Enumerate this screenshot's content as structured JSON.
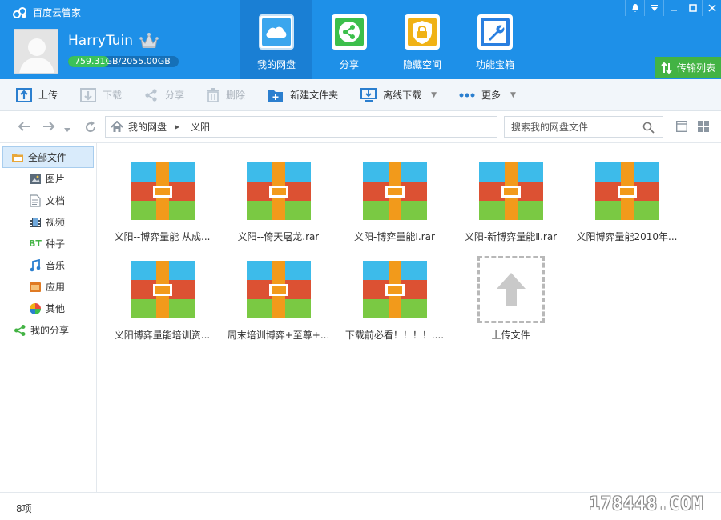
{
  "app": {
    "title": "百度云管家"
  },
  "user": {
    "name": "HarryTuin",
    "quota_used": "759.31",
    "quota_total": "GB/2055.00GB",
    "quota_fraction": 0.369
  },
  "nav_tabs": [
    {
      "label": "我的网盘",
      "icon": "cloud-icon",
      "color": "#1b9be8"
    },
    {
      "label": "分享",
      "icon": "share-icon",
      "color": "#3cbf4b"
    },
    {
      "label": "隐藏空间",
      "icon": "lock-icon",
      "color": "#f0b215"
    },
    {
      "label": "功能宝箱",
      "icon": "wrench-icon",
      "color": "#2a7fe0"
    }
  ],
  "window_controls": [
    "bell-icon",
    "dropdown-icon",
    "minimize-icon",
    "maximize-icon",
    "close-icon"
  ],
  "transfer_list": {
    "label": "传输列表"
  },
  "toolbar": {
    "upload": "上传",
    "download": "下载",
    "share": "分享",
    "delete": "删除",
    "new_folder": "新建文件夹",
    "offline_download": "离线下载",
    "more": "更多"
  },
  "address": {
    "root": "我的网盘",
    "current": "义阳",
    "search_placeholder": "搜索我的网盘文件"
  },
  "sidebar": {
    "items": [
      {
        "label": "全部文件",
        "icon": "all-files-icon",
        "level": 1,
        "active": true
      },
      {
        "label": "图片",
        "icon": "picture-icon",
        "level": 2
      },
      {
        "label": "文档",
        "icon": "document-icon",
        "level": 2
      },
      {
        "label": "视频",
        "icon": "video-icon",
        "level": 2
      },
      {
        "label": "种子",
        "icon": "bt-icon",
        "level": 2
      },
      {
        "label": "音乐",
        "icon": "music-icon",
        "level": 2
      },
      {
        "label": "应用",
        "icon": "app-icon",
        "level": 2
      },
      {
        "label": "其他",
        "icon": "other-icon",
        "level": 2
      },
      {
        "label": "我的分享",
        "icon": "my-share-icon",
        "level": 1
      }
    ]
  },
  "files": [
    {
      "name": "义阳--博弈量能 从成..."
    },
    {
      "name": "义阳--倚天屠龙.rar"
    },
    {
      "name": "义阳-博弈量能Ⅰ.rar"
    },
    {
      "name": "义阳-新博弈量能Ⅱ.rar"
    },
    {
      "name": "义阳博弈量能2010年..."
    },
    {
      "name": "义阳博弈量能培训资..."
    },
    {
      "name": "周末培训博弈+至尊+..."
    },
    {
      "name": "下载前必看！！！！...."
    }
  ],
  "upload_tile": {
    "label": "上传文件"
  },
  "status": {
    "count": "8项",
    "watermark": "178448.COM"
  }
}
